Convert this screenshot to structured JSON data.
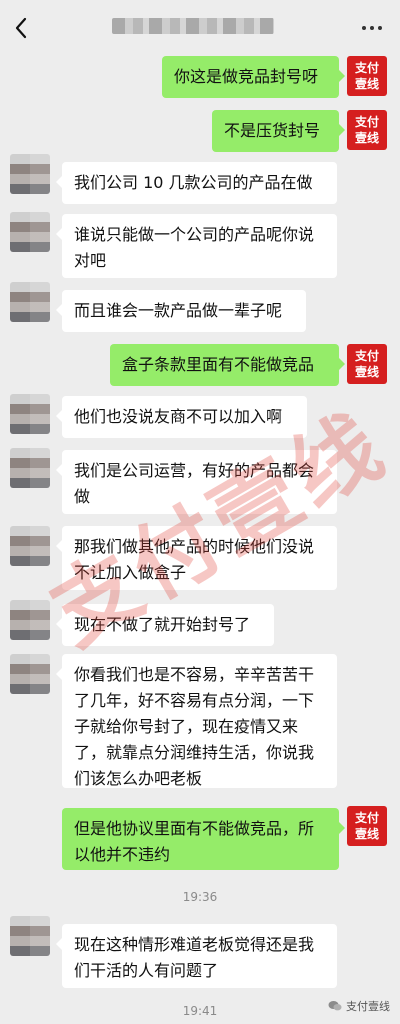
{
  "header": {
    "title": ""
  },
  "brand": {
    "avatar_line1": "支付",
    "avatar_line2": "壹线",
    "watermark_text": "支付壹线",
    "footer_label": "支付壹线",
    "accent": "#d51f1f"
  },
  "messages": [
    {
      "side": "right",
      "text": "你这是做竞品封号呀"
    },
    {
      "side": "right",
      "text": "不是压货封号"
    },
    {
      "side": "left",
      "text": "我们公司 10 几款公司的产品在做"
    },
    {
      "side": "left",
      "text": "谁说只能做一个公司的产品呢你说对吧"
    },
    {
      "side": "left",
      "text": "而且谁会一款产品做一辈子呢"
    },
    {
      "side": "right",
      "text": "盒子条款里面有不能做竞品"
    },
    {
      "side": "left",
      "text": "他们也没说友商不可以加入啊"
    },
    {
      "side": "left",
      "text": "我们是公司运营，有好的产品都会做"
    },
    {
      "side": "left",
      "text": "那我们做其他产品的时候他们没说不让加入做盒子"
    },
    {
      "side": "left",
      "text": "现在不做了就开始封号了"
    },
    {
      "side": "left",
      "text": "你看我们也是不容易，辛辛苦苦干了几年，好不容易有点分润，一下子就给你号封了，现在疫情又来了，就靠点分润维持生活，你说我们该怎么办吧老板"
    },
    {
      "side": "right",
      "text": "但是他协议里面有不能做竞品，所以他并不违约"
    },
    {
      "side": "left",
      "text": "现在这种情形难道老板觉得还是我们干活的人有问题了"
    }
  ],
  "timestamps": [
    "19:36",
    "19:41"
  ]
}
